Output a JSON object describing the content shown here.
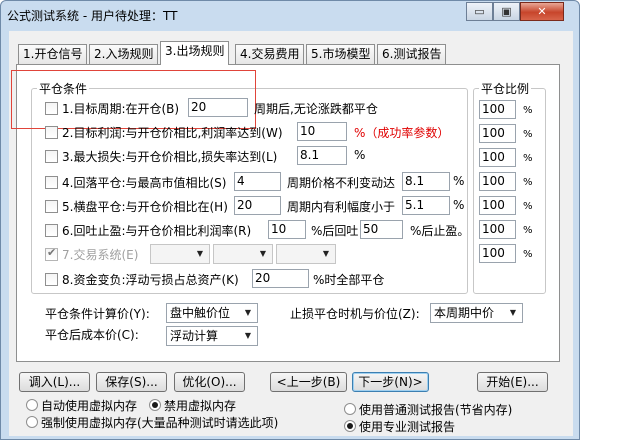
{
  "window": {
    "title": "公式测试系统 - 用户待处理：TT",
    "minimize_glyph": "▭",
    "maximize_glyph": "▣",
    "close_glyph": "✕"
  },
  "tabs": [
    {
      "label": "1.开仓信号"
    },
    {
      "label": "2.入场规则"
    },
    {
      "label": "3.出场规则"
    },
    {
      "label": "4.交易费用"
    },
    {
      "label": "5.市场模型"
    },
    {
      "label": "6.测试报告"
    }
  ],
  "exit_conditions": {
    "group_title": "平仓条件",
    "ratio_title": "平仓比例",
    "percent_symbol": "%",
    "rows": [
      {
        "checked": false,
        "label": "1.目标周期:在开仓(B)",
        "value": "20",
        "suffix": "周期后,无论涨跌都平仓",
        "ratio": "100"
      },
      {
        "checked": false,
        "label": "2.目标利润:与开仓价相比,利润率达到(W)",
        "value": "10",
        "suffix": "%（成功率参数）",
        "ratio": "100"
      },
      {
        "checked": false,
        "label": "3.最大损失:与开仓价相比,损失率达到(L)",
        "value": "8.1",
        "suffix": "%",
        "ratio": "100"
      },
      {
        "checked": false,
        "label": "4.回落平仓:与最高市值相比(S)",
        "value": "4",
        "mid": "周期价格不利变动达",
        "value2": "8.1",
        "suffix": "%",
        "ratio": "100"
      },
      {
        "checked": false,
        "label": "5.横盘平仓:与开仓价相比在(H)",
        "value": "20",
        "mid": "周期内有利幅度小于",
        "value2": "5.1",
        "suffix": "%",
        "ratio": "100"
      },
      {
        "checked": false,
        "label": "6.回吐止盈:与开仓价相比利润率(R)",
        "value": "10",
        "mid": "%后回吐",
        "value2": "50",
        "suffix": "%后止盈。",
        "ratio": "100"
      },
      {
        "checked": true,
        "label": "7.交易系统(E)",
        "disabled": true,
        "ratio": "100"
      },
      {
        "checked": false,
        "label": "8.资金变负:浮动亏损占总资产(K)",
        "value": "20",
        "suffix": "%时全部平仓"
      }
    ]
  },
  "price_settings": {
    "calc_price_label": "平仓条件计算价(Y):",
    "calc_price_value": "盘中触价位",
    "stop_timing_label": "止损平仓时机与价位(Z):",
    "stop_timing_value": "本周期中价",
    "cost_price_label": "平仓后成本价(C):",
    "cost_price_value": "浮动计算"
  },
  "buttons": {
    "load": "调入(L)...",
    "save": "保存(S)...",
    "optimize": "优化(O)...",
    "prev": "<上一步(B)",
    "next": "下一步(N)>",
    "start": "开始(E)..."
  },
  "memory_options": {
    "auto_virtual": "自动使用虚拟内存",
    "disable_virtual": "禁用虚拟内存",
    "force_virtual": "强制使用虚拟内存(大量品种测试时请选此项)",
    "normal_report": "使用普通测试报告(节省内存)",
    "pro_report": "使用专业测试报告",
    "selected_memory": "disable_virtual",
    "selected_report": "pro_report"
  },
  "icons": {
    "dropdown": "▼"
  }
}
